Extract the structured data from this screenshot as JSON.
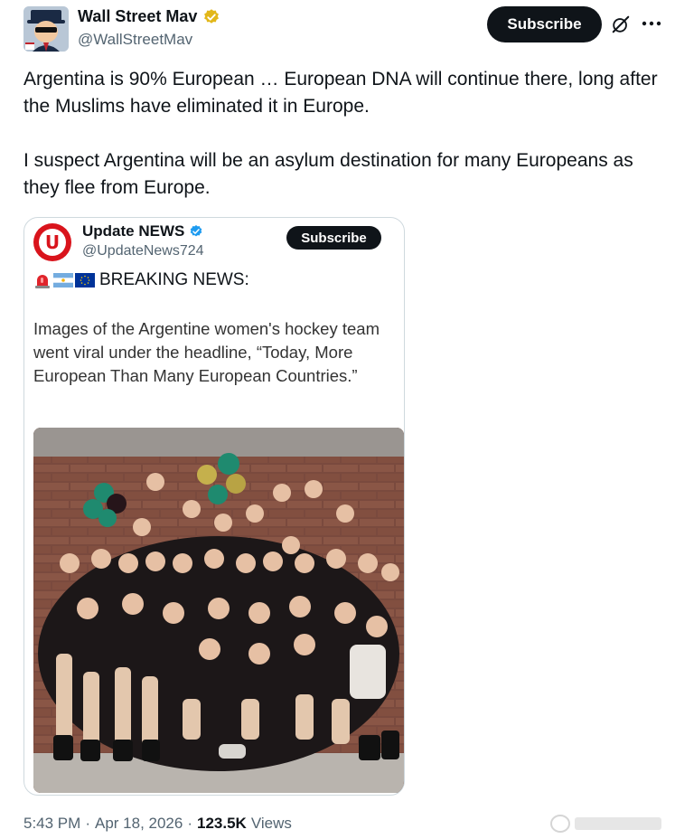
{
  "author": {
    "display_name": "Wall Street Mav",
    "handle": "@WallStreetMav",
    "verified_color": "#e2b719"
  },
  "header": {
    "subscribe_label": "Subscribe",
    "icons": [
      "grok-icon",
      "more-icon"
    ]
  },
  "post": {
    "paragraphs": [
      "Argentina is 90% European … European DNA will continue there, long after the Muslims have eliminated it in Europe.",
      "I suspect Argentina will be an asylum destination for many Europeans as they flee from Europe."
    ]
  },
  "quoted_image": {
    "name": "Update NEWS",
    "handle": "@UpdateNews724",
    "logo_letter": "U",
    "subscribe_label": "Subscribe",
    "breaking_icons": [
      "siren-icon",
      "argentina-flag-icon",
      "eu-flag-icon"
    ],
    "breaking_label": "BREAKING NEWS:",
    "text": "Images of the Argentine women's hockey team went viral under the headline, “Today, More European Than Many European Countries.”"
  },
  "footer": {
    "time": "5:43 PM",
    "date": "Apr 18, 2026",
    "views_count": "123.5K",
    "views_label": "Views"
  },
  "colors": {
    "text": "#0f1419",
    "secondary": "#536471",
    "border": "#cfd9de",
    "accent_red": "#d9141c",
    "verified_blue": "#1d9bf0"
  }
}
